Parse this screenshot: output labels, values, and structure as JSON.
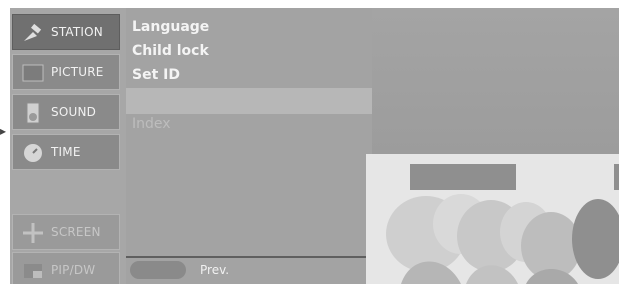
{
  "sidebar": {
    "items": [
      {
        "label": "STATION",
        "icon": "satellite-icon"
      },
      {
        "label": "PICTURE",
        "icon": "picture-icon"
      },
      {
        "label": "SOUND",
        "icon": "speaker-icon"
      },
      {
        "label": "TIME",
        "icon": "clock-icon"
      },
      {
        "label": "SCREEN",
        "icon": "screen-adjust-icon"
      },
      {
        "label": "PIP/DW",
        "icon": "pip-icon"
      }
    ]
  },
  "submenu": {
    "items": [
      "Language",
      "Child lock",
      "Set ID",
      "",
      "Index"
    ]
  },
  "footer": {
    "prev_label": "Prev."
  },
  "colors": {
    "menu_bg": "#a3a3a3",
    "active_item": "#707070",
    "item_bg": "#8a8a8a",
    "text": "#f4f4f4"
  }
}
